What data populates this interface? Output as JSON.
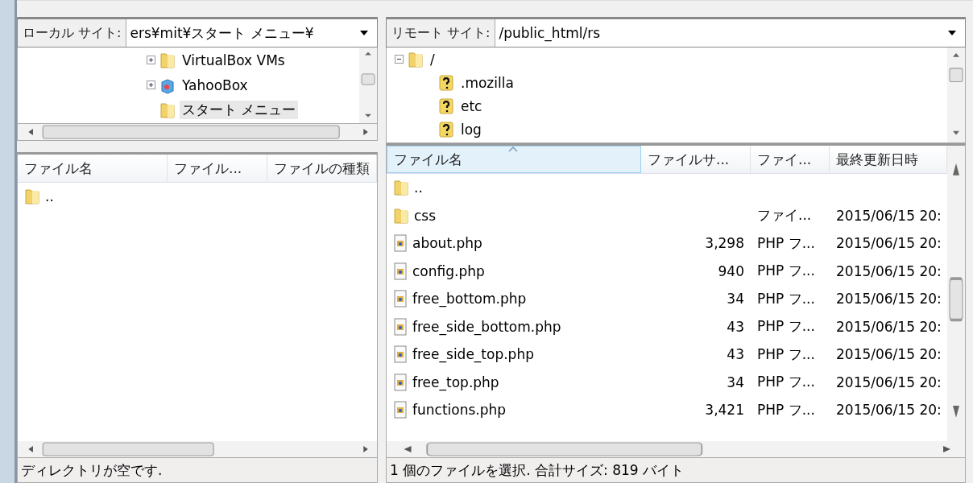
{
  "local": {
    "label": "ローカル サイト:",
    "path": "ers¥mit¥スタート メニュー¥",
    "tree": [
      {
        "name": "VirtualBox VMs",
        "kind": "folder",
        "expanded": false,
        "selected": false
      },
      {
        "name": "YahooBox",
        "kind": "box",
        "expanded": false,
        "selected": false
      },
      {
        "name": "スタート メニュー",
        "kind": "folder",
        "selected": true
      }
    ],
    "columns": [
      {
        "label": "ファイル名",
        "sorted": false
      },
      {
        "label": "ファイル...",
        "sorted": false
      },
      {
        "label": "ファイルの種類",
        "sorted": false
      }
    ],
    "rows": [
      {
        "kind": "folder",
        "cells": [
          ".."
        ]
      }
    ],
    "status": "ディレクトリが空です."
  },
  "remote": {
    "label": "リモート サイト:",
    "path": "/public_html/rs",
    "tree": [
      {
        "name": "/",
        "kind": "folder",
        "expanded": true,
        "selected": false,
        "children": [
          {
            "name": ".mozilla",
            "kind": "unknown",
            "selected": false
          },
          {
            "name": "etc",
            "kind": "unknown",
            "selected": false
          },
          {
            "name": "log",
            "kind": "unknown",
            "selected": false
          }
        ]
      }
    ],
    "columns": [
      {
        "label": "ファイル名",
        "sorted": true
      },
      {
        "label": "ファイルサ...",
        "sorted": false
      },
      {
        "label": "ファイ...",
        "sorted": false
      },
      {
        "label": "最終更新日時",
        "sorted": false
      }
    ],
    "rows": [
      {
        "kind": "folder",
        "cells": [
          "..",
          "",
          "",
          ""
        ]
      },
      {
        "kind": "folder",
        "cells": [
          "css",
          "",
          "ファイ...",
          "2015/06/15 20:"
        ]
      },
      {
        "kind": "php",
        "cells": [
          "about.php",
          "3,298",
          "PHP フ...",
          "2015/06/15 20:"
        ]
      },
      {
        "kind": "php",
        "cells": [
          "config.php",
          "940",
          "PHP フ...",
          "2015/06/15 20:"
        ]
      },
      {
        "kind": "php",
        "cells": [
          "free_bottom.php",
          "34",
          "PHP フ...",
          "2015/06/15 20:"
        ]
      },
      {
        "kind": "php",
        "cells": [
          "free_side_bottom.php",
          "43",
          "PHP フ...",
          "2015/06/15 20:"
        ]
      },
      {
        "kind": "php",
        "cells": [
          "free_side_top.php",
          "43",
          "PHP フ...",
          "2015/06/15 20:"
        ]
      },
      {
        "kind": "php",
        "cells": [
          "free_top.php",
          "34",
          "PHP フ...",
          "2015/06/15 20:"
        ]
      },
      {
        "kind": "php",
        "cells": [
          "functions.php",
          "3,421",
          "PHP フ...",
          "2015/06/15 20:"
        ]
      }
    ],
    "status": "1 個のファイルを選択. 合計サイズ: 819 バイト"
  }
}
